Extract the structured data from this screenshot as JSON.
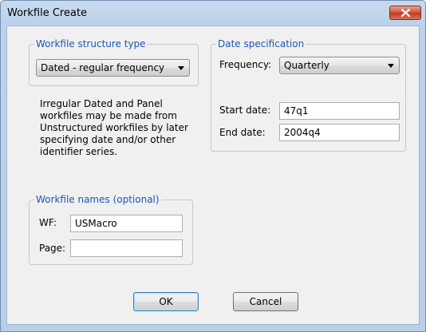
{
  "window": {
    "title": "Workfile Create"
  },
  "structure": {
    "legend": "Workfile structure type",
    "selected": "Dated - regular frequency",
    "note": "Irregular Dated and Panel workfiles may be made from Unstructured workfiles by later specifying date and/or other identifier series."
  },
  "date_spec": {
    "legend": "Date specification",
    "frequency_label": "Frequency:",
    "frequency_value": "Quarterly",
    "start_label": "Start date:",
    "start_value": "47q1",
    "end_label": "End date:",
    "end_value": "2004q4"
  },
  "names": {
    "legend": "Workfile names (optional)",
    "wf_label": "WF:",
    "wf_value": "USMacro",
    "page_label": "Page:",
    "page_value": ""
  },
  "buttons": {
    "ok_label": "OK",
    "cancel_label": "Cancel"
  }
}
